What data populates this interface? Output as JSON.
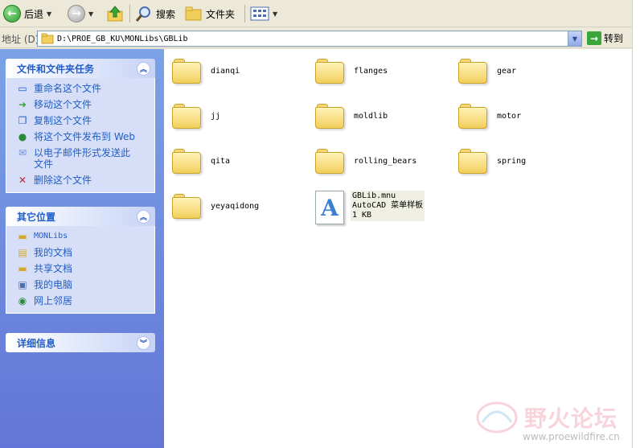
{
  "toolbar": {
    "back": "后退",
    "search": "搜索",
    "folders": "文件夹"
  },
  "address": {
    "label": "地址 (D)",
    "path": "D:\\PROE_GB_KU\\MONLibs\\GBLib",
    "go": "转到"
  },
  "sidebar": {
    "tasks": {
      "title": "文件和文件夹任务",
      "items": [
        "重命名这个文件",
        "移动这个文件",
        "复制这个文件",
        "将这个文件发布到 Web",
        "以电子邮件形式发送此文件",
        "删除这个文件"
      ]
    },
    "places": {
      "title": "其它位置",
      "items": [
        "MONLibs",
        "我的文档",
        "共享文档",
        "我的电脑",
        "网上邻居"
      ]
    },
    "details": {
      "title": "详细信息"
    }
  },
  "files": {
    "folders": [
      "dianqi",
      "flanges",
      "gear",
      "jj",
      "moldlib",
      "motor",
      "qita",
      "rolling_bears",
      "spring",
      "yeyaqidong"
    ],
    "selected_file": {
      "name": "GBLib.mnu",
      "type": "AutoCAD 菜单样板",
      "size": "1 KB"
    }
  },
  "watermark": {
    "text": "野火论坛",
    "url": "www.proewildfire.cn"
  }
}
